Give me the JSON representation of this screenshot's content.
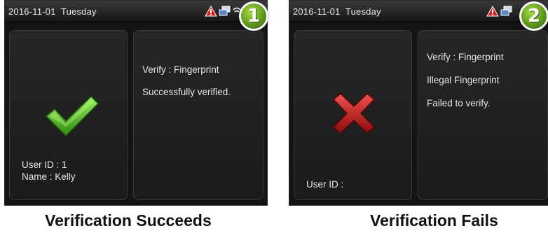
{
  "colors": {
    "screen_bg": "#141414",
    "panel_bg": "#262626",
    "text": "#e6e6e6",
    "success_green": "#5cc821",
    "fail_red": "#c01818",
    "badge_green": "#5e9a1e"
  },
  "screens": [
    {
      "step_number": "1",
      "date": "2016-11-01  Tuesday",
      "status_icons": [
        "alarm-warning-icon",
        "network-icon",
        "wifi-icon"
      ],
      "result_icon": "checkmark-icon",
      "left_lines": [
        "User ID : 1",
        "Name : Kelly"
      ],
      "right_lines": [
        "Verify : Fingerprint",
        "Successfully verified."
      ],
      "caption": "Verification Succeeds"
    },
    {
      "step_number": "2",
      "date": "2016-11-01  Tuesday",
      "status_icons": [
        "alarm-warning-icon",
        "network-icon"
      ],
      "result_icon": "cross-icon",
      "left_lines": [
        "User ID :"
      ],
      "right_lines": [
        "Verify : Fingerprint",
        "Illegal Fingerprint",
        "Failed to verify."
      ],
      "caption": "Verification Fails"
    }
  ]
}
